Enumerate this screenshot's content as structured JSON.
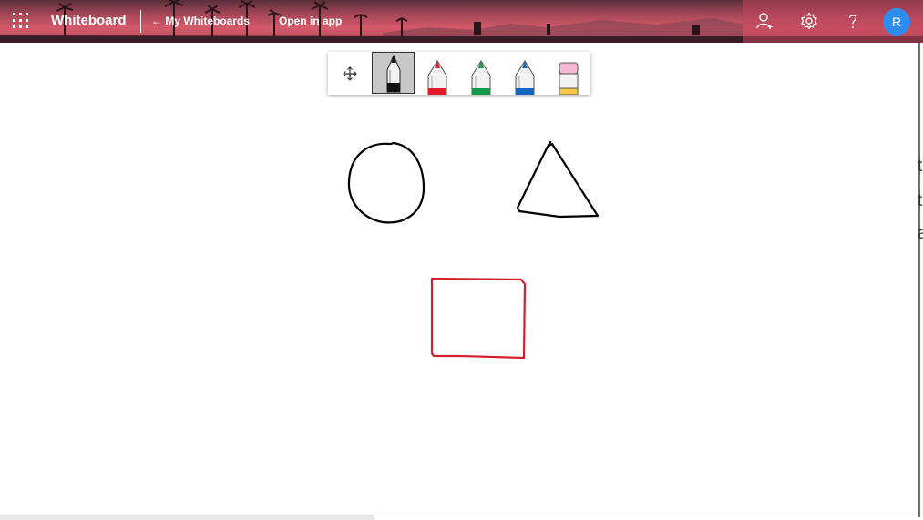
{
  "header": {
    "app_title": "Whiteboard",
    "back_link": "← My Whiteboards",
    "open_in_app": "Open in app",
    "icons": [
      "apps-waffle-icon",
      "share-person-icon",
      "settings-gear-icon",
      "help-question-icon"
    ],
    "avatar_initial": "R",
    "avatar_color": "#2d8cf0"
  },
  "toolbar": {
    "tools": [
      {
        "name": "move-pan-icon",
        "selected": false
      },
      {
        "name": "black-pen",
        "color": "#111111",
        "selected": true
      },
      {
        "name": "red-pen",
        "color": "#e11b2a",
        "selected": false
      },
      {
        "name": "green-pen",
        "color": "#109a4a",
        "selected": false
      },
      {
        "name": "blue-pen",
        "color": "#1565c0",
        "selected": false
      },
      {
        "name": "eraser",
        "color": "#f5b8d4",
        "selected": false
      }
    ]
  },
  "canvas": {
    "shapes": [
      {
        "type": "circle",
        "stroke": "#000000"
      },
      {
        "type": "triangle",
        "stroke": "#000000"
      },
      {
        "type": "rectangle",
        "stroke": "#d21f2b"
      }
    ]
  },
  "side_text": [
    "t",
    "t",
    "a"
  ]
}
